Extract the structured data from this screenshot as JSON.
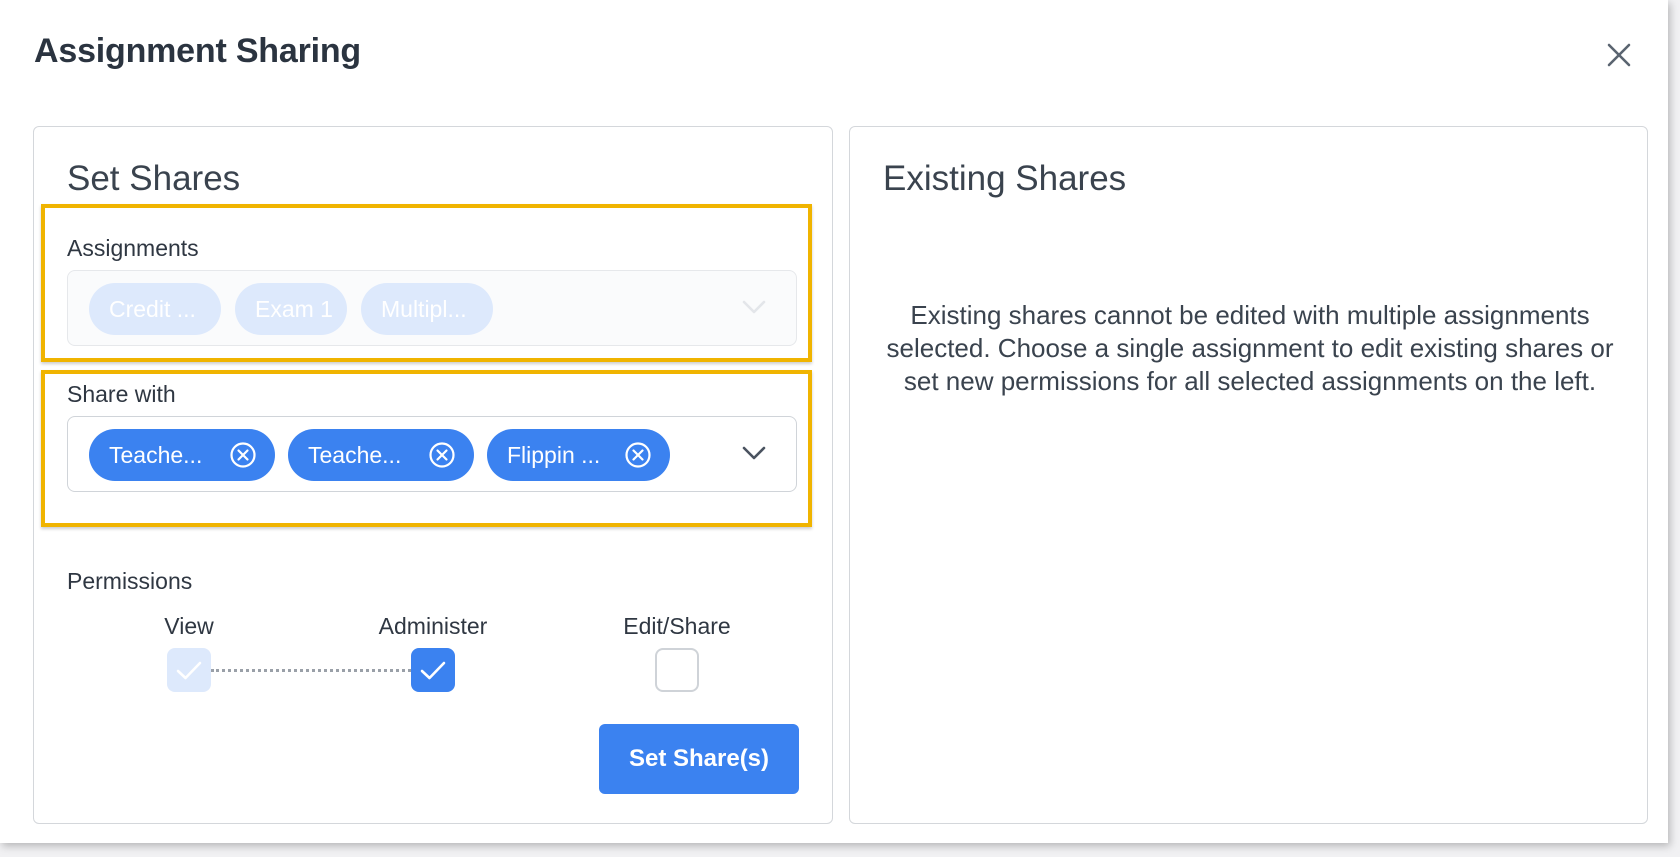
{
  "dialog": {
    "title": "Assignment Sharing"
  },
  "set_shares": {
    "title": "Set Shares",
    "assignments": {
      "label": "Assignments",
      "chips": [
        "Credit ...",
        "Exam 1",
        "Multipl..."
      ]
    },
    "share_with": {
      "label": "Share with",
      "chips": [
        "Teache...",
        "Teache...",
        "Flippin ..."
      ]
    },
    "permissions": {
      "label": "Permissions",
      "options": [
        {
          "label": "View",
          "checked": true,
          "disabled": true
        },
        {
          "label": "Administer",
          "checked": true,
          "disabled": false
        },
        {
          "label": "Edit/Share",
          "checked": false,
          "disabled": false
        }
      ]
    },
    "submit_label": "Set Share(s)"
  },
  "existing_shares": {
    "title": "Existing Shares",
    "message": "Existing shares cannot be edited with multiple assignments selected. Choose a single assignment to edit existing shares or set new permissions for all selected assignments on the left."
  },
  "colors": {
    "primary": "#3b82f0",
    "primary_disabled": "#dde9fc",
    "highlight": "#f0b400"
  },
  "icons": {
    "close": "close-icon",
    "chevron": "chevron-down-icon",
    "chip_remove": "remove-circle-icon",
    "check": "check-icon"
  }
}
